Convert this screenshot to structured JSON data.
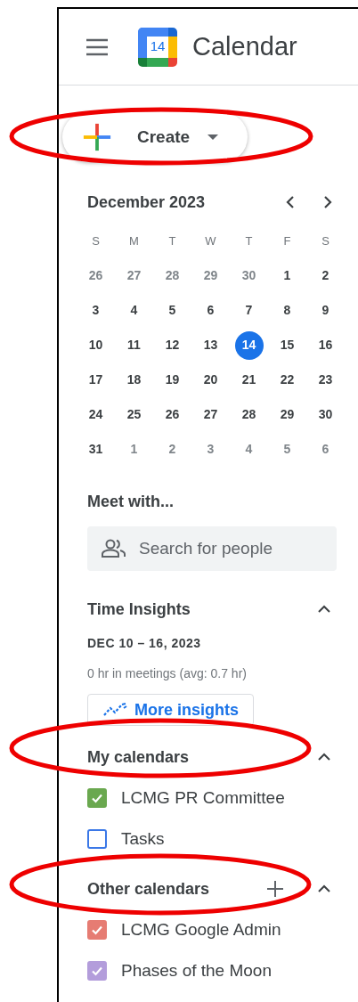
{
  "header": {
    "title": "Calendar",
    "logo_day": "14"
  },
  "create_button": {
    "label": "Create"
  },
  "mini_calendar": {
    "month": "December 2023",
    "weekdays": [
      "S",
      "M",
      "T",
      "W",
      "T",
      "F",
      "S"
    ],
    "days": [
      {
        "label": "26",
        "muted": true,
        "selected": false
      },
      {
        "label": "27",
        "muted": true,
        "selected": false
      },
      {
        "label": "28",
        "muted": true,
        "selected": false
      },
      {
        "label": "29",
        "muted": true,
        "selected": false
      },
      {
        "label": "30",
        "muted": true,
        "selected": false
      },
      {
        "label": "1",
        "muted": false,
        "selected": false
      },
      {
        "label": "2",
        "muted": false,
        "selected": false
      },
      {
        "label": "3",
        "muted": false,
        "selected": false
      },
      {
        "label": "4",
        "muted": false,
        "selected": false
      },
      {
        "label": "5",
        "muted": false,
        "selected": false
      },
      {
        "label": "6",
        "muted": false,
        "selected": false
      },
      {
        "label": "7",
        "muted": false,
        "selected": false
      },
      {
        "label": "8",
        "muted": false,
        "selected": false
      },
      {
        "label": "9",
        "muted": false,
        "selected": false
      },
      {
        "label": "10",
        "muted": false,
        "selected": false
      },
      {
        "label": "11",
        "muted": false,
        "selected": false
      },
      {
        "label": "12",
        "muted": false,
        "selected": false
      },
      {
        "label": "13",
        "muted": false,
        "selected": false
      },
      {
        "label": "14",
        "muted": false,
        "selected": true
      },
      {
        "label": "15",
        "muted": false,
        "selected": false
      },
      {
        "label": "16",
        "muted": false,
        "selected": false
      },
      {
        "label": "17",
        "muted": false,
        "selected": false
      },
      {
        "label": "18",
        "muted": false,
        "selected": false
      },
      {
        "label": "19",
        "muted": false,
        "selected": false
      },
      {
        "label": "20",
        "muted": false,
        "selected": false
      },
      {
        "label": "21",
        "muted": false,
        "selected": false
      },
      {
        "label": "22",
        "muted": false,
        "selected": false
      },
      {
        "label": "23",
        "muted": false,
        "selected": false
      },
      {
        "label": "24",
        "muted": false,
        "selected": false
      },
      {
        "label": "25",
        "muted": false,
        "selected": false
      },
      {
        "label": "26",
        "muted": false,
        "selected": false
      },
      {
        "label": "27",
        "muted": false,
        "selected": false
      },
      {
        "label": "28",
        "muted": false,
        "selected": false
      },
      {
        "label": "29",
        "muted": false,
        "selected": false
      },
      {
        "label": "30",
        "muted": false,
        "selected": false
      },
      {
        "label": "31",
        "muted": false,
        "selected": false
      },
      {
        "label": "1",
        "muted": true,
        "selected": false
      },
      {
        "label": "2",
        "muted": true,
        "selected": false
      },
      {
        "label": "3",
        "muted": true,
        "selected": false
      },
      {
        "label": "4",
        "muted": true,
        "selected": false
      },
      {
        "label": "5",
        "muted": true,
        "selected": false
      },
      {
        "label": "6",
        "muted": true,
        "selected": false
      }
    ]
  },
  "meet_with": {
    "title": "Meet with...",
    "search": {
      "placeholder": "Search for people"
    }
  },
  "time_insights": {
    "title": "Time Insights",
    "expanded": true,
    "range": "DEC 10 – 16, 2023",
    "summary": "0 hr in meetings (avg: 0.7 hr)",
    "button": "More insights"
  },
  "my_calendars": {
    "title": "My calendars",
    "expanded": true,
    "items": [
      {
        "name": "LCMG PR Committee",
        "checked": true,
        "color": "#6aa84f"
      },
      {
        "name": "Tasks",
        "checked": false,
        "color": "#3b78e7"
      }
    ]
  },
  "other_calendars": {
    "title": "Other calendars",
    "expanded": true,
    "items": [
      {
        "name": "LCMG Google Admin",
        "checked": true,
        "color": "#e67c73"
      },
      {
        "name": "Phases of the Moon",
        "checked": true,
        "color": "#b39ddb"
      }
    ]
  }
}
